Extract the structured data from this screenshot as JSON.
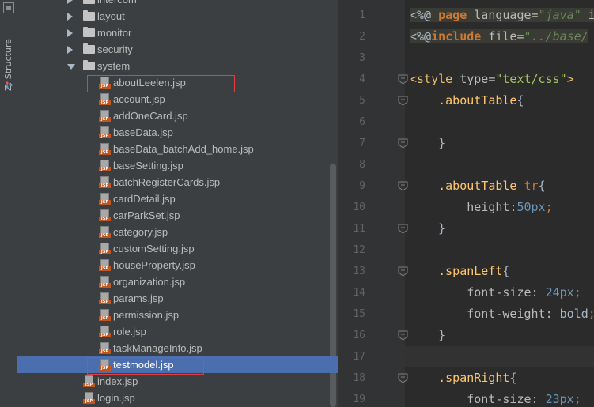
{
  "toolstrip": {
    "structure_tab_label": "Z: Structure"
  },
  "tree": {
    "items": [
      {
        "type": "folder",
        "label": "intercom",
        "level": 1,
        "expanded": false
      },
      {
        "type": "folder",
        "label": "layout",
        "level": 1,
        "expanded": false
      },
      {
        "type": "folder",
        "label": "monitor",
        "level": 1,
        "expanded": false
      },
      {
        "type": "folder",
        "label": "security",
        "level": 1,
        "expanded": false
      },
      {
        "type": "folder",
        "label": "system",
        "level": 1,
        "expanded": true
      },
      {
        "type": "file",
        "label": "aboutLeelen.jsp",
        "level": 2,
        "highlighted": true
      },
      {
        "type": "file",
        "label": "account.jsp",
        "level": 2
      },
      {
        "type": "file",
        "label": "addOneCard.jsp",
        "level": 2
      },
      {
        "type": "file",
        "label": "baseData.jsp",
        "level": 2
      },
      {
        "type": "file",
        "label": "baseData_batchAdd_home.jsp",
        "level": 2
      },
      {
        "type": "file",
        "label": "baseSetting.jsp",
        "level": 2
      },
      {
        "type": "file",
        "label": "batchRegisterCards.jsp",
        "level": 2
      },
      {
        "type": "file",
        "label": "cardDetail.jsp",
        "level": 2
      },
      {
        "type": "file",
        "label": "carParkSet.jsp",
        "level": 2
      },
      {
        "type": "file",
        "label": "category.jsp",
        "level": 2
      },
      {
        "type": "file",
        "label": "customSetting.jsp",
        "level": 2
      },
      {
        "type": "file",
        "label": "houseProperty.jsp",
        "level": 2
      },
      {
        "type": "file",
        "label": "organization.jsp",
        "level": 2
      },
      {
        "type": "file",
        "label": "params.jsp",
        "level": 2
      },
      {
        "type": "file",
        "label": "permission.jsp",
        "level": 2
      },
      {
        "type": "file",
        "label": "role.jsp",
        "level": 2
      },
      {
        "type": "file",
        "label": "taskManageInfo.jsp",
        "level": 2
      },
      {
        "type": "file",
        "label": "testmodel.jsp",
        "level": 2,
        "selected": true,
        "highlighted": true
      },
      {
        "type": "file",
        "label": "index.jsp",
        "level": 1
      },
      {
        "type": "file",
        "label": "login.jsp",
        "level": 1
      }
    ]
  },
  "editor": {
    "line_numbers": [
      "1",
      "2",
      "3",
      "4",
      "5",
      "6",
      "7",
      "8",
      "9",
      "10",
      "11",
      "12",
      "13",
      "14",
      "15",
      "16",
      "17",
      "18",
      "19"
    ],
    "lines": [
      [
        {
          "c": "t-dir",
          "t": "<%@ "
        },
        {
          "c": "t-kw",
          "t": "page "
        },
        {
          "c": "t-attr",
          "t": "language="
        },
        {
          "c": "t-str",
          "t": "\"java\" "
        },
        {
          "c": "t-attr",
          "t": "i"
        }
      ],
      [
        {
          "c": "t-dir",
          "t": "<%@"
        },
        {
          "c": "t-kw",
          "t": "include "
        },
        {
          "c": "t-attr",
          "t": "file="
        },
        {
          "c": "t-str",
          "t": "\"../base/"
        }
      ],
      [],
      [
        {
          "c": "t-tag",
          "t": "<style "
        },
        {
          "c": "t-tattr",
          "t": "type="
        },
        {
          "c": "t-tstr",
          "t": "\"text/css\""
        },
        {
          "c": "t-tag",
          "t": ">"
        }
      ],
      [
        {
          "c": "t-val",
          "t": "    "
        },
        {
          "c": "t-sel",
          "t": ".aboutTable"
        },
        {
          "c": "t-val",
          "t": "{"
        }
      ],
      [],
      [
        {
          "c": "t-val",
          "t": "    }"
        }
      ],
      [],
      [
        {
          "c": "t-val",
          "t": "    "
        },
        {
          "c": "t-sel",
          "t": ".aboutTable "
        },
        {
          "c": "t-elem",
          "t": "tr"
        },
        {
          "c": "t-val",
          "t": "{"
        }
      ],
      [
        {
          "c": "t-val",
          "t": "        "
        },
        {
          "c": "t-prop",
          "t": "height"
        },
        {
          "c": "t-val",
          "t": ":"
        },
        {
          "c": "t-num",
          "t": "50px"
        },
        {
          "c": "t-punc",
          "t": ";"
        }
      ],
      [
        {
          "c": "t-val",
          "t": "    }"
        }
      ],
      [],
      [
        {
          "c": "t-val",
          "t": "    "
        },
        {
          "c": "t-sel",
          "t": ".spanLeft"
        },
        {
          "c": "t-val",
          "t": "{"
        }
      ],
      [
        {
          "c": "t-val",
          "t": "        "
        },
        {
          "c": "t-prop",
          "t": "font-size"
        },
        {
          "c": "t-val",
          "t": ": "
        },
        {
          "c": "t-num",
          "t": "24px"
        },
        {
          "c": "t-punc",
          "t": ";"
        }
      ],
      [
        {
          "c": "t-val",
          "t": "        "
        },
        {
          "c": "t-prop",
          "t": "font-weight"
        },
        {
          "c": "t-val",
          "t": ": bold"
        },
        {
          "c": "t-punc",
          "t": ";"
        }
      ],
      [
        {
          "c": "t-val",
          "t": "    }"
        }
      ],
      [],
      [
        {
          "c": "t-val",
          "t": "    "
        },
        {
          "c": "t-sel",
          "t": ".spanRight"
        },
        {
          "c": "t-val",
          "t": "{"
        }
      ],
      [
        {
          "c": "t-val",
          "t": "        "
        },
        {
          "c": "t-prop",
          "t": "font-size"
        },
        {
          "c": "t-val",
          "t": ": "
        },
        {
          "c": "t-num",
          "t": "23px"
        },
        {
          "c": "t-punc",
          "t": ";"
        }
      ]
    ],
    "fold_markers": [
      "4",
      "5",
      "7",
      "9",
      "11",
      "13",
      "16",
      "18"
    ]
  },
  "colors": {
    "selection": "#4b6eaf",
    "highlight_box": "#e04040",
    "jsp_icon": "#c0561f"
  }
}
